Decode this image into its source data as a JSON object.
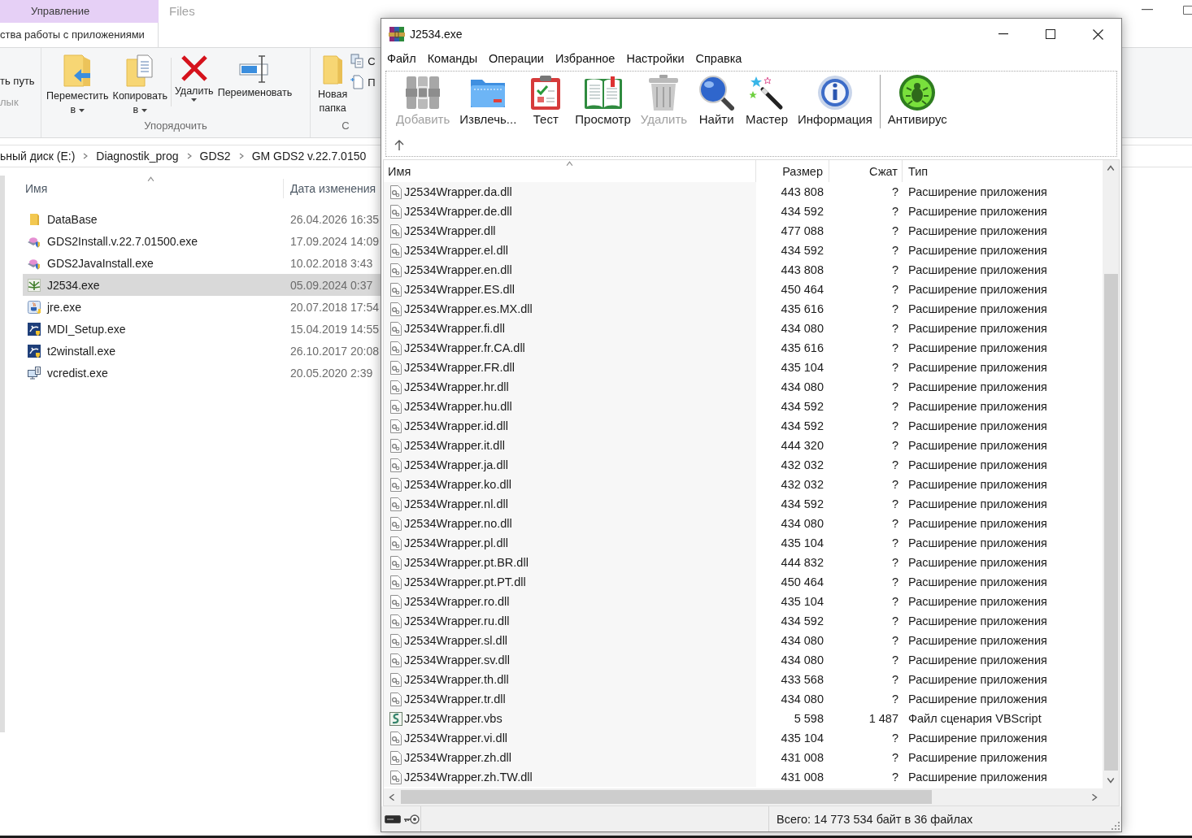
{
  "explorer": {
    "title": "Files",
    "context_tab": {
      "label": "Управление",
      "subtitle": "ства работы с приложениями"
    },
    "ribbon_groups": [
      {
        "items": [
          {
            "kind": "text",
            "lines": [
              "ть путь"
            ],
            "disabled": false
          },
          {
            "kind": "text",
            "lines": [
              "лык"
            ],
            "disabled": true
          }
        ]
      },
      {
        "label": "Упорядочить",
        "items": [
          {
            "kind": "large",
            "lines": [
              "Переместить",
              "в"
            ],
            "menu": true,
            "disabled": false
          },
          {
            "kind": "large",
            "lines": [
              "Копировать",
              "в"
            ],
            "menu": true,
            "disabled": false
          },
          {
            "kind": "separator"
          },
          {
            "kind": "large",
            "lines": [
              "Удалить"
            ],
            "menu": true,
            "disabled": false
          },
          {
            "kind": "large",
            "lines": [
              "Переименовать"
            ],
            "menu": false,
            "disabled": false
          }
        ]
      },
      {
        "label": "С",
        "items": [
          {
            "kind": "large",
            "lines": [
              "Новая",
              "папка"
            ],
            "menu": false,
            "disabled": false
          },
          {
            "kind": "small",
            "lines": [
              "С"
            ],
            "disabled": false
          },
          {
            "kind": "small",
            "lines": [
              "П"
            ],
            "disabled": false
          }
        ]
      }
    ],
    "path": [
      "ьный диск (E:)",
      "Diagnostik_prog",
      "GDS2",
      "GM GDS2 v.22.7.0150"
    ],
    "columns": [
      "Имя",
      "Дата изменения"
    ],
    "files": [
      {
        "name": "DataBase",
        "modified": "26.04.2026 16:35",
        "kind": "folder",
        "selected": false
      },
      {
        "name": "GDS2Install.v.22.7.01500.exe",
        "modified": "17.09.2024 14:09",
        "kind": "installer",
        "selected": false
      },
      {
        "name": "GDS2JavaInstall.exe",
        "modified": "10.02.2018 3:43",
        "kind": "installer",
        "selected": false
      },
      {
        "name": "J2534.exe",
        "modified": "05.09.2024 0:37",
        "kind": "plant",
        "selected": true
      },
      {
        "name": "jre.exe",
        "modified": "20.07.2018 17:54",
        "kind": "java",
        "selected": false
      },
      {
        "name": "MDI_Setup.exe",
        "modified": "15.04.2019 14:55",
        "kind": "blueapp",
        "selected": false
      },
      {
        "name": "t2winstall.exe",
        "modified": "26.10.2017 20:08",
        "kind": "blueapp",
        "selected": false
      },
      {
        "name": "vcredist.exe",
        "modified": "20.05.2020 2:39",
        "kind": "redist",
        "selected": false
      }
    ]
  },
  "archiver": {
    "title": "J2534.exe",
    "menu": [
      "Файл",
      "Команды",
      "Операции",
      "Избранное",
      "Настройки",
      "Справка"
    ],
    "toolbar": [
      {
        "kind": "button",
        "label": "Добавить",
        "disabled": true
      },
      {
        "kind": "button",
        "label": "Извлечь...",
        "disabled": false
      },
      {
        "kind": "button",
        "label": "Тест",
        "disabled": false
      },
      {
        "kind": "button",
        "label": "Просмотр",
        "disabled": false
      },
      {
        "kind": "button",
        "label": "Удалить",
        "disabled": true
      },
      {
        "kind": "button",
        "label": "Найти",
        "disabled": false
      },
      {
        "kind": "button",
        "label": "Мастер",
        "disabled": false
      },
      {
        "kind": "button",
        "label": "Информация",
        "disabled": false
      },
      {
        "kind": "separator"
      },
      {
        "kind": "button",
        "label": "Антивирус",
        "disabled": false
      }
    ],
    "columns": [
      "Имя",
      "Размер",
      "Сжат",
      "Тип"
    ],
    "rows": [
      {
        "kind": "dll",
        "name": "J2534Wrapper.da.dll",
        "size": "443 808",
        "packed": "?",
        "type": "Расширение приложения"
      },
      {
        "kind": "dll",
        "name": "J2534Wrapper.de.dll",
        "size": "434 592",
        "packed": "?",
        "type": "Расширение приложения"
      },
      {
        "kind": "dll",
        "name": "J2534Wrapper.dll",
        "size": "477 088",
        "packed": "?",
        "type": "Расширение приложения"
      },
      {
        "kind": "dll",
        "name": "J2534Wrapper.el.dll",
        "size": "434 592",
        "packed": "?",
        "type": "Расширение приложения"
      },
      {
        "kind": "dll",
        "name": "J2534Wrapper.en.dll",
        "size": "443 808",
        "packed": "?",
        "type": "Расширение приложения"
      },
      {
        "kind": "dll",
        "name": "J2534Wrapper.ES.dll",
        "size": "450 464",
        "packed": "?",
        "type": "Расширение приложения"
      },
      {
        "kind": "dll",
        "name": "J2534Wrapper.es.MX.dll",
        "size": "435 616",
        "packed": "?",
        "type": "Расширение приложения"
      },
      {
        "kind": "dll",
        "name": "J2534Wrapper.fi.dll",
        "size": "434 080",
        "packed": "?",
        "type": "Расширение приложения"
      },
      {
        "kind": "dll",
        "name": "J2534Wrapper.fr.CA.dll",
        "size": "435 616",
        "packed": "?",
        "type": "Расширение приложения"
      },
      {
        "kind": "dll",
        "name": "J2534Wrapper.FR.dll",
        "size": "435 104",
        "packed": "?",
        "type": "Расширение приложения"
      },
      {
        "kind": "dll",
        "name": "J2534Wrapper.hr.dll",
        "size": "434 080",
        "packed": "?",
        "type": "Расширение приложения"
      },
      {
        "kind": "dll",
        "name": "J2534Wrapper.hu.dll",
        "size": "434 592",
        "packed": "?",
        "type": "Расширение приложения"
      },
      {
        "kind": "dll",
        "name": "J2534Wrapper.id.dll",
        "size": "434 592",
        "packed": "?",
        "type": "Расширение приложения"
      },
      {
        "kind": "dll",
        "name": "J2534Wrapper.it.dll",
        "size": "444 320",
        "packed": "?",
        "type": "Расширение приложения"
      },
      {
        "kind": "dll",
        "name": "J2534Wrapper.ja.dll",
        "size": "432 032",
        "packed": "?",
        "type": "Расширение приложения"
      },
      {
        "kind": "dll",
        "name": "J2534Wrapper.ko.dll",
        "size": "432 032",
        "packed": "?",
        "type": "Расширение приложения"
      },
      {
        "kind": "dll",
        "name": "J2534Wrapper.nl.dll",
        "size": "434 592",
        "packed": "?",
        "type": "Расширение приложения"
      },
      {
        "kind": "dll",
        "name": "J2534Wrapper.no.dll",
        "size": "434 080",
        "packed": "?",
        "type": "Расширение приложения"
      },
      {
        "kind": "dll",
        "name": "J2534Wrapper.pl.dll",
        "size": "435 104",
        "packed": "?",
        "type": "Расширение приложения"
      },
      {
        "kind": "dll",
        "name": "J2534Wrapper.pt.BR.dll",
        "size": "444 832",
        "packed": "?",
        "type": "Расширение приложения"
      },
      {
        "kind": "dll",
        "name": "J2534Wrapper.pt.PT.dll",
        "size": "450 464",
        "packed": "?",
        "type": "Расширение приложения"
      },
      {
        "kind": "dll",
        "name": "J2534Wrapper.ro.dll",
        "size": "435 104",
        "packed": "?",
        "type": "Расширение приложения"
      },
      {
        "kind": "dll",
        "name": "J2534Wrapper.ru.dll",
        "size": "434 592",
        "packed": "?",
        "type": "Расширение приложения"
      },
      {
        "kind": "dll",
        "name": "J2534Wrapper.sl.dll",
        "size": "434 080",
        "packed": "?",
        "type": "Расширение приложения"
      },
      {
        "kind": "dll",
        "name": "J2534Wrapper.sv.dll",
        "size": "434 080",
        "packed": "?",
        "type": "Расширение приложения"
      },
      {
        "kind": "dll",
        "name": "J2534Wrapper.th.dll",
        "size": "433 568",
        "packed": "?",
        "type": "Расширение приложения"
      },
      {
        "kind": "dll",
        "name": "J2534Wrapper.tr.dll",
        "size": "434 080",
        "packed": "?",
        "type": "Расширение приложения"
      },
      {
        "kind": "script",
        "name": "J2534Wrapper.vbs",
        "size": "5 598",
        "packed": "1 487",
        "type": "Файл сценария VBScript"
      },
      {
        "kind": "dll",
        "name": "J2534Wrapper.vi.dll",
        "size": "435 104",
        "packed": "?",
        "type": "Расширение приложения"
      },
      {
        "kind": "dll",
        "name": "J2534Wrapper.zh.dll",
        "size": "431 008",
        "packed": "?",
        "type": "Расширение приложения"
      },
      {
        "kind": "dll",
        "name": "J2534Wrapper.zh.TW.dll",
        "size": "431 008",
        "packed": "?",
        "type": "Расширение приложения"
      }
    ],
    "status": "Всего: 14 773 534 байт в 36 файлах"
  }
}
